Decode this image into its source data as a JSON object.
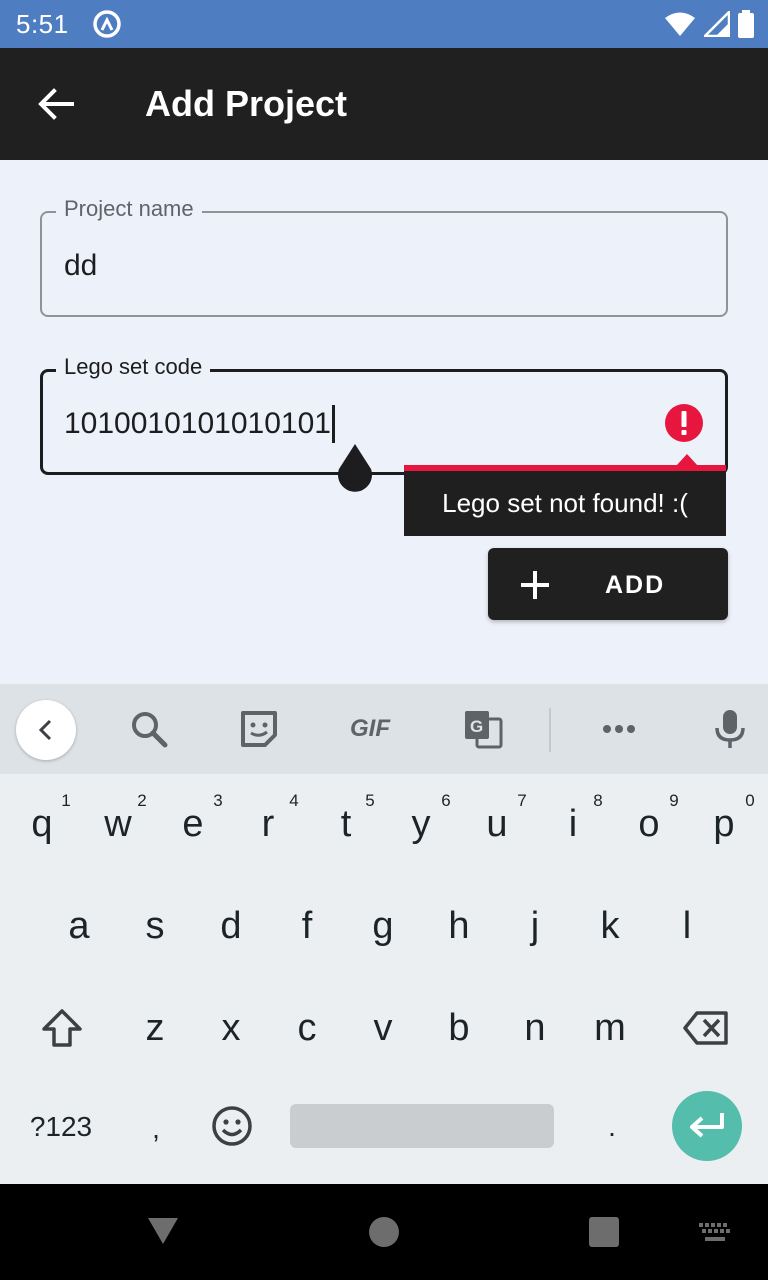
{
  "status_bar": {
    "time": "5:51",
    "icons": [
      "app-notification-icon",
      "wifi-icon",
      "cellular-signal-icon",
      "battery-icon"
    ]
  },
  "app_bar": {
    "title": "Add Project",
    "back_icon": "arrow-back-icon"
  },
  "form": {
    "project_name": {
      "label": "Project name",
      "value": "dd"
    },
    "lego_set_code": {
      "label": "Lego set code",
      "value": "1010010101010101",
      "error_message": "Lego set not found! :(",
      "error_icon": "error-icon"
    },
    "add_button": {
      "label": "ADD",
      "icon": "plus-icon"
    }
  },
  "keyboard": {
    "toolbar_icons": [
      "chevron-left-icon",
      "search-icon",
      "sticker-icon",
      "gif-icon",
      "translate-icon",
      "more-icon",
      "microphone-icon"
    ],
    "gif_label": "GIF",
    "row1": [
      {
        "key": "q",
        "hint": "1"
      },
      {
        "key": "w",
        "hint": "2"
      },
      {
        "key": "e",
        "hint": "3"
      },
      {
        "key": "r",
        "hint": "4"
      },
      {
        "key": "t",
        "hint": "5"
      },
      {
        "key": "y",
        "hint": "6"
      },
      {
        "key": "u",
        "hint": "7"
      },
      {
        "key": "i",
        "hint": "8"
      },
      {
        "key": "o",
        "hint": "9"
      },
      {
        "key": "p",
        "hint": "0"
      }
    ],
    "row2": [
      "a",
      "s",
      "d",
      "f",
      "g",
      "h",
      "j",
      "k",
      "l"
    ],
    "row3": [
      "z",
      "x",
      "c",
      "v",
      "b",
      "n",
      "m"
    ],
    "symbols_label": "?123",
    "comma": ",",
    "period": ".",
    "emoji_icon": "emoji-icon",
    "shift_icon": "shift-icon",
    "backspace_icon": "backspace-icon",
    "enter_icon": "enter-icon"
  },
  "colors": {
    "status_bar": "#4f7dc2",
    "app_bar": "#202020",
    "background": "#edf1f9",
    "error": "#e6163f",
    "enter_key": "#54bdab"
  }
}
